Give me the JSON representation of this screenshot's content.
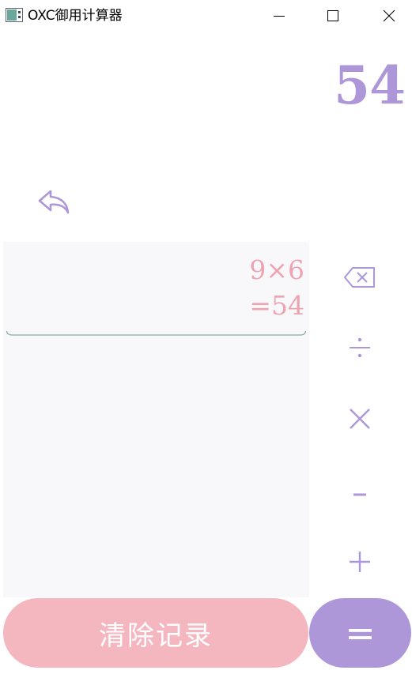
{
  "window": {
    "title": "OXC御用计算器",
    "icon": "calculator-app-icon",
    "controls": [
      "minimize-icon",
      "maximize-icon",
      "close-icon"
    ]
  },
  "display": {
    "result": "54"
  },
  "history": {
    "entries": [
      {
        "expression": "9×6",
        "result": "=54"
      }
    ]
  },
  "operators": {
    "backspace": "backspace-icon",
    "divide": "divide-icon",
    "multiply": "multiply-icon",
    "subtract": "minus-icon",
    "add": "plus-icon"
  },
  "buttons": {
    "clear_label": "清除记录",
    "equals_label": "="
  },
  "colors": {
    "accent_purple": "#ad97d8",
    "accent_pink": "#f4b7bf",
    "history_text": "#eda4b1",
    "history_bg": "#f8f8fb",
    "divider": "#7fae9e"
  }
}
